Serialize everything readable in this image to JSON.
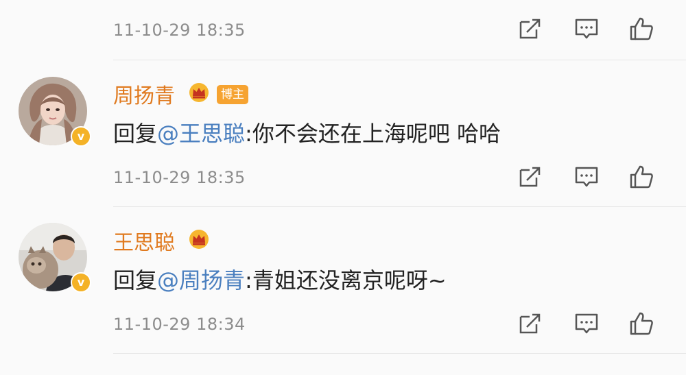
{
  "comments": [
    {
      "timestamp": "11-10-29 18:35",
      "actions": [
        "share-icon",
        "comment-icon",
        "like-icon"
      ]
    },
    {
      "author": "周扬青",
      "author_badge": "博主",
      "verified_mark": "v",
      "reply_prefix": "回复",
      "mention": "@王思聪",
      "text": ":你不会还在上海呢吧 哈哈",
      "timestamp": "11-10-29 18:35",
      "actions": [
        "share-icon",
        "comment-icon",
        "like-icon"
      ]
    },
    {
      "author": "王思聪",
      "verified_mark": "v",
      "reply_prefix": "回复",
      "mention": "@周扬青",
      "text": ":青姐还没离京呢呀~",
      "timestamp": "11-10-29 18:34",
      "actions": [
        "share-icon",
        "comment-icon",
        "like-icon"
      ]
    }
  ],
  "colors": {
    "author_name": "#e07a1f",
    "mention": "#4a7fbf",
    "timestamp": "#8c8c8c",
    "verified_badge": "#f4b227",
    "host_badge": "#f6a331"
  }
}
